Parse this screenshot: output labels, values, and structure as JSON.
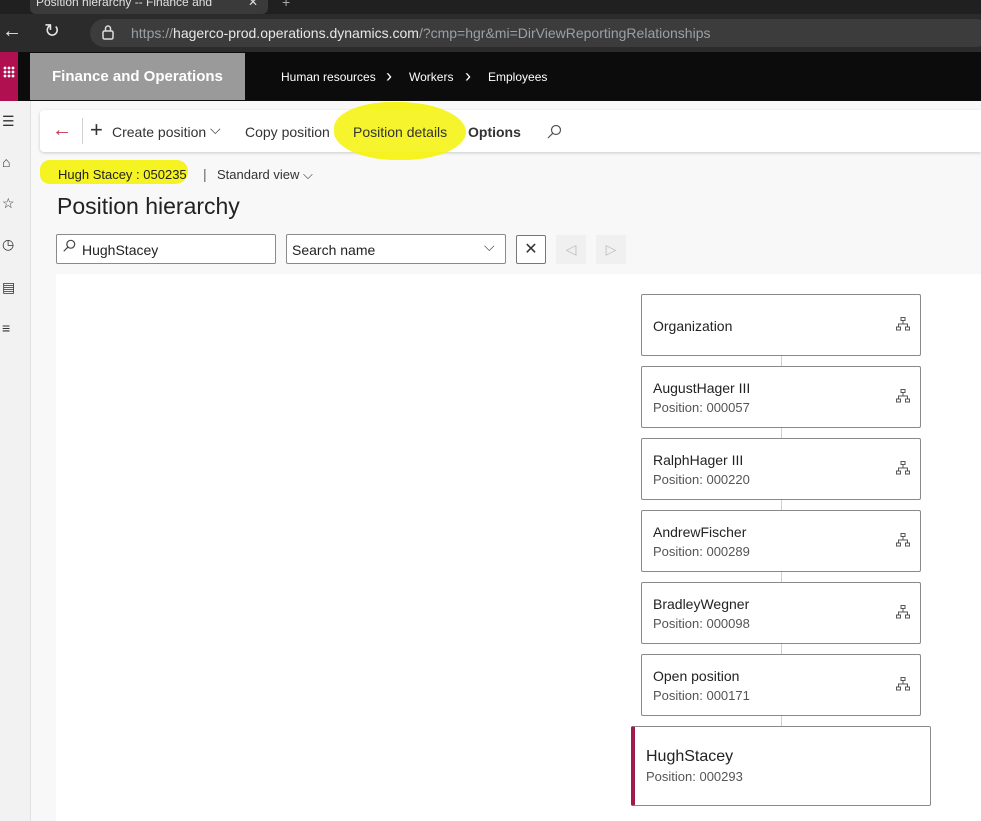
{
  "browser": {
    "tab_title": "Position hierarchy -- Finance and",
    "url_prefix": "https://",
    "url_host": "hagerco-prod.operations.dynamics.com",
    "url_rest": "/?cmp=hgr&mi=DirViewReportingRelationships"
  },
  "app": {
    "title": "Finance and Operations",
    "breadcrumb": [
      "Human resources",
      "Workers",
      "Employees"
    ]
  },
  "actions": {
    "create_position": "Create position",
    "copy_position": "Copy position",
    "position_details": "Position details",
    "options": "Options"
  },
  "record": {
    "label": "Hugh Stacey : 050235",
    "view": "Standard view"
  },
  "page": {
    "title": "Position hierarchy"
  },
  "search": {
    "value": "HughStacey",
    "field": "Search name"
  },
  "hierarchy": [
    {
      "name": "Organization",
      "position": ""
    },
    {
      "name": "AugustHager III",
      "position": "Position: 000057"
    },
    {
      "name": "RalphHager III",
      "position": "Position: 000220"
    },
    {
      "name": "AndrewFischer",
      "position": "Position: 000289"
    },
    {
      "name": "BradleyWegner",
      "position": "Position: 000098"
    },
    {
      "name": "Open position",
      "position": "Position: 000171"
    },
    {
      "name": "HughStacey",
      "position": "Position: 000293"
    }
  ],
  "colors": {
    "accent": "#a1194d",
    "highlight": "#f5f321"
  }
}
